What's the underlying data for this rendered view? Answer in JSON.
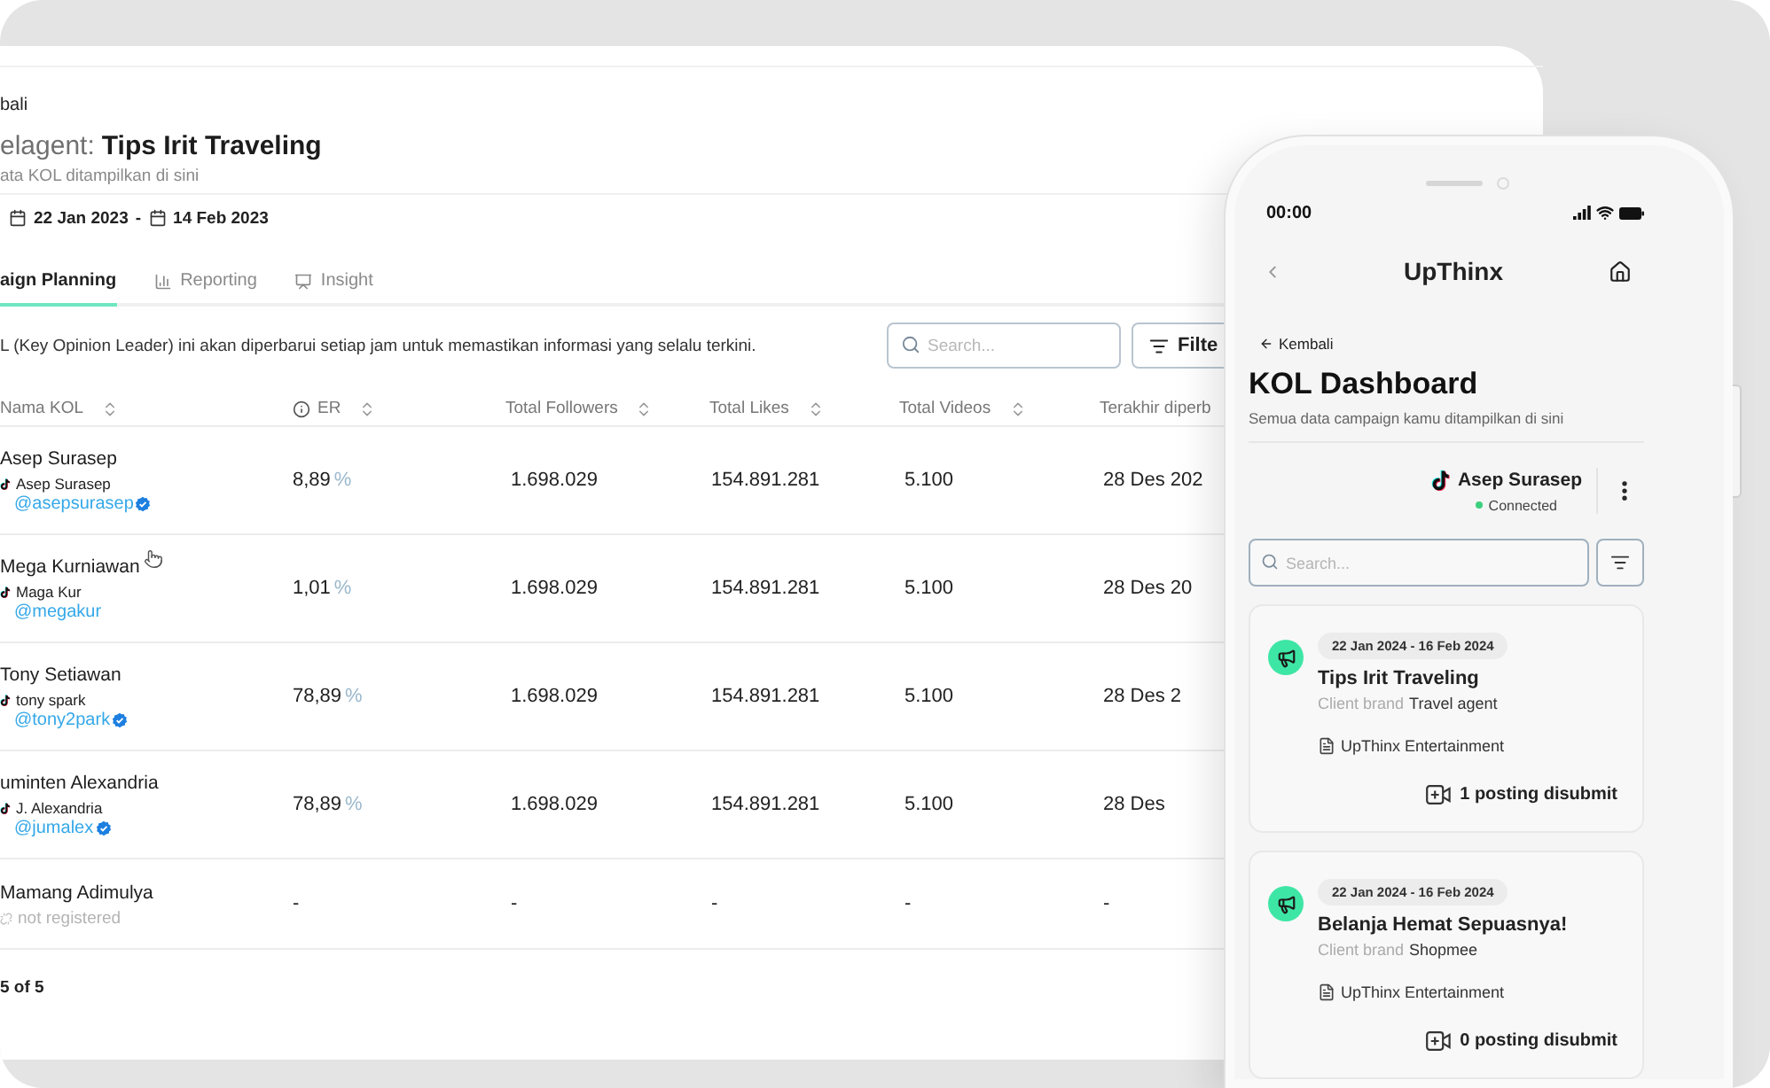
{
  "desktop": {
    "back_link": "bali",
    "title_prefix": "elagent:",
    "title": "Tips Irit Traveling",
    "subtitle": "ata KOL ditampilkan di sini",
    "date_start": "22 Jan 2023",
    "date_separator": "-",
    "date_end": "14 Feb 2023",
    "tabs": [
      {
        "label": "aign Planning",
        "selected": true
      },
      {
        "label": "Reporting",
        "selected": false
      },
      {
        "label": "Insight",
        "selected": false
      }
    ],
    "notice": "L (Key Opinion Leader) ini akan diperbarui setiap jam untuk memastikan informasi yang selalu terkini.",
    "search": {
      "placeholder": "Search..."
    },
    "filter_button": "Filte",
    "table": {
      "columns": [
        {
          "label": "Nama KOL",
          "sortable": true,
          "info": false
        },
        {
          "label": "ER",
          "sortable": true,
          "info": true
        },
        {
          "label": "Total Followers",
          "sortable": true,
          "info": false
        },
        {
          "label": "Total Likes",
          "sortable": true,
          "info": false
        },
        {
          "label": "Total Videos",
          "sortable": true,
          "info": false
        },
        {
          "label": "Terakhir diperb",
          "sortable": false,
          "info": false
        }
      ],
      "rows": [
        {
          "name": "Asep Surasep",
          "registered": true,
          "account": "Asep Surasep",
          "handle": "@asepsurasep",
          "verified": true,
          "er": "8,89",
          "er_unit": "%",
          "followers": "1.698.029",
          "likes": "154.891.281",
          "videos": "5.100",
          "updated": "28 Des 202"
        },
        {
          "name": "Mega Kurniawan",
          "registered": true,
          "account": "Maga Kur",
          "handle": "@megakur",
          "verified": false,
          "er": "1,01",
          "er_unit": "%",
          "followers": "1.698.029",
          "likes": "154.891.281",
          "videos": "5.100",
          "updated": "28 Des 20"
        },
        {
          "name": "Tony Setiawan",
          "registered": true,
          "account": "tony spark",
          "handle": "@tony2park",
          "verified": true,
          "er": "78,89",
          "er_unit": "%",
          "followers": "1.698.029",
          "likes": "154.891.281",
          "videos": "5.100",
          "updated": "28 Des 2"
        },
        {
          "name": "uminten Alexandria",
          "registered": true,
          "account": "J. Alexandria",
          "handle": "@jumalex",
          "verified": true,
          "er": "78,89",
          "er_unit": "%",
          "followers": "1.698.029",
          "likes": "154.891.281",
          "videos": "5.100",
          "updated": "28 Des"
        },
        {
          "name": "Mamang Adimulya",
          "registered": false,
          "status": "not registered",
          "er": "-",
          "followers": "-",
          "likes": "-",
          "videos": "-",
          "updated": "-"
        }
      ]
    },
    "footer": "5 of 5"
  },
  "phone": {
    "time": "00:00",
    "app_title": "UpThinx",
    "back_link": "Kembali",
    "title": "KOL Dashboard",
    "subtitle": "Semua data campaign kamu ditampilkan di sini",
    "account": {
      "name": "Asep Surasep",
      "status": "Connected",
      "connected": true
    },
    "search": {
      "placeholder": "Search..."
    },
    "campaigns": [
      {
        "date_range": "22 Jan 2024 - 16 Feb 2024",
        "title": "Tips Irit Traveling",
        "brand_label": "Client brand",
        "brand": "Travel agent",
        "agency": "UpThinx Entertainment",
        "posts": "1 posting disubmit"
      },
      {
        "date_range": "22 Jan 2024 - 16 Feb 2024",
        "title": "Belanja Hemat Sepuasnya!",
        "brand_label": "Client brand",
        "brand": "Shopmee",
        "agency": "UpThinx Entertainment",
        "posts": "0 posting disubmit"
      }
    ]
  }
}
